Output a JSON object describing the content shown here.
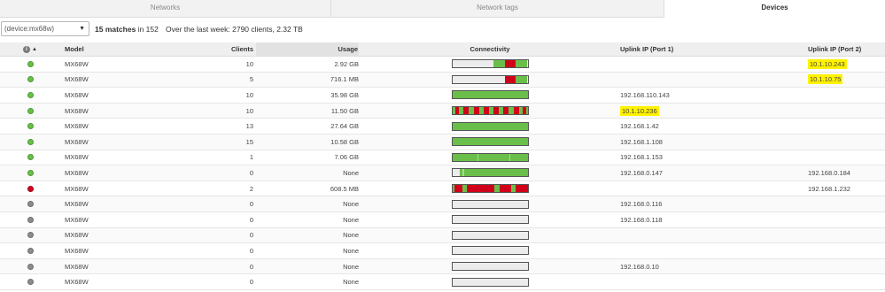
{
  "tabs": [
    {
      "label": "Networks",
      "active": false
    },
    {
      "label": "Network tags",
      "active": false
    },
    {
      "label": "Devices",
      "active": true
    }
  ],
  "toolbar": {
    "search_value": "(device:mx68w)",
    "matches_count": "15 matches",
    "matches_total": "in 152",
    "summary": "Over the last week: 2790 clients, 2.32 TB"
  },
  "columns": {
    "status_icon": "info-icon",
    "model": "Model",
    "clients": "Clients",
    "usage": "Usage",
    "connectivity": "Connectivity",
    "uplink1": "Uplink IP (Port 1)",
    "uplink2": "Uplink IP (Port 2)"
  },
  "colors": {
    "online": "#6abf4b",
    "offline": "#d0021b",
    "dormant": "#8c8c8c",
    "highlight": "#fff200"
  },
  "rows": [
    {
      "status": "online",
      "model": "MX68W",
      "clients": "10",
      "usage": "2.92 GB",
      "uplink1": "",
      "uplink2": "10.1.10.243",
      "uplink1_hl": false,
      "uplink2_hl": true,
      "connectivity": [
        {
          "s": 0,
          "e": 0.55,
          "c": "none"
        },
        {
          "s": 0.55,
          "e": 0.7,
          "c": "green"
        },
        {
          "s": 0.7,
          "e": 0.84,
          "c": "red"
        },
        {
          "s": 0.84,
          "e": 1,
          "c": "green"
        }
      ]
    },
    {
      "status": "online",
      "model": "MX68W",
      "clients": "5",
      "usage": "716.1 MB",
      "uplink1": "",
      "uplink2": "10.1.10.75",
      "uplink1_hl": false,
      "uplink2_hl": true,
      "connectivity": [
        {
          "s": 0,
          "e": 0.7,
          "c": "none"
        },
        {
          "s": 0.7,
          "e": 0.84,
          "c": "red"
        },
        {
          "s": 0.84,
          "e": 1,
          "c": "green"
        }
      ]
    },
    {
      "status": "online",
      "model": "MX68W",
      "clients": "10",
      "usage": "35.98 GB",
      "uplink1": "192.168.110.143",
      "uplink2": "",
      "uplink1_hl": false,
      "uplink2_hl": false,
      "connectivity": [
        {
          "s": 0,
          "e": 1,
          "c": "green"
        }
      ]
    },
    {
      "status": "online",
      "model": "MX68W",
      "clients": "10",
      "usage": "11.50 GB",
      "uplink1": "10.1.10.236",
      "uplink2": "",
      "uplink1_hl": true,
      "uplink2_hl": false,
      "connectivity": [
        {
          "s": 0,
          "e": 1,
          "c": "green"
        },
        {
          "s": 0.04,
          "e": 0.09,
          "c": "red"
        },
        {
          "s": 0.15,
          "e": 0.22,
          "c": "red"
        },
        {
          "s": 0.29,
          "e": 0.36,
          "c": "red"
        },
        {
          "s": 0.42,
          "e": 0.49,
          "c": "red"
        },
        {
          "s": 0.55,
          "e": 0.62,
          "c": "red"
        },
        {
          "s": 0.68,
          "e": 0.75,
          "c": "red"
        },
        {
          "s": 0.82,
          "e": 0.89,
          "c": "red"
        },
        {
          "s": 0.93,
          "e": 0.98,
          "c": "red"
        }
      ]
    },
    {
      "status": "online",
      "model": "MX68W",
      "clients": "13",
      "usage": "27.64 GB",
      "uplink1": "192.168.1.42",
      "uplink2": "",
      "uplink1_hl": false,
      "uplink2_hl": false,
      "connectivity": [
        {
          "s": 0,
          "e": 1,
          "c": "green"
        }
      ]
    },
    {
      "status": "online",
      "model": "MX68W",
      "clients": "15",
      "usage": "10.58 GB",
      "uplink1": "192.168.1.108",
      "uplink2": "",
      "uplink1_hl": false,
      "uplink2_hl": false,
      "connectivity": [
        {
          "s": 0,
          "e": 1,
          "c": "green"
        }
      ]
    },
    {
      "status": "online",
      "model": "MX68W",
      "clients": "1",
      "usage": "7.06 GB",
      "uplink1": "192.168.1.153",
      "uplink2": "",
      "uplink1_hl": false,
      "uplink2_hl": false,
      "connectivity": [
        {
          "s": 0,
          "e": 1,
          "c": "green"
        },
        {
          "s": 0.33,
          "e": 0.345,
          "c": "lightgreen"
        },
        {
          "s": 0.76,
          "e": 0.775,
          "c": "lightgreen"
        }
      ]
    },
    {
      "status": "online",
      "model": "MX68W",
      "clients": "0",
      "usage": "None",
      "uplink1": "192.168.0.147",
      "uplink2": "192.168.0.184",
      "uplink1_hl": false,
      "uplink2_hl": false,
      "connectivity": [
        {
          "s": 0,
          "e": 0.1,
          "c": "none"
        },
        {
          "s": 0.1,
          "e": 1,
          "c": "green"
        },
        {
          "s": 0.14,
          "e": 0.155,
          "c": "lightgreen"
        }
      ]
    },
    {
      "status": "offline",
      "model": "MX68W",
      "clients": "2",
      "usage": "608.5 MB",
      "uplink1": "",
      "uplink2": "192.168.1.232",
      "uplink1_hl": false,
      "uplink2_hl": false,
      "connectivity": [
        {
          "s": 0,
          "e": 1,
          "c": "red"
        },
        {
          "s": 0.0,
          "e": 0.03,
          "c": "green"
        },
        {
          "s": 0.13,
          "e": 0.2,
          "c": "green"
        },
        {
          "s": 0.56,
          "e": 0.63,
          "c": "green"
        },
        {
          "s": 0.78,
          "e": 0.84,
          "c": "green"
        }
      ]
    },
    {
      "status": "dormant",
      "model": "MX68W",
      "clients": "0",
      "usage": "None",
      "uplink1": "192.168.0.116",
      "uplink2": "",
      "uplink1_hl": false,
      "uplink2_hl": false,
      "connectivity": []
    },
    {
      "status": "dormant",
      "model": "MX68W",
      "clients": "0",
      "usage": "None",
      "uplink1": "192.168.0.118",
      "uplink2": "",
      "uplink1_hl": false,
      "uplink2_hl": false,
      "connectivity": []
    },
    {
      "status": "dormant",
      "model": "MX68W",
      "clients": "0",
      "usage": "None",
      "uplink1": "",
      "uplink2": "",
      "uplink1_hl": false,
      "uplink2_hl": false,
      "connectivity": []
    },
    {
      "status": "dormant",
      "model": "MX68W",
      "clients": "0",
      "usage": "None",
      "uplink1": "",
      "uplink2": "",
      "uplink1_hl": false,
      "uplink2_hl": false,
      "connectivity": []
    },
    {
      "status": "dormant",
      "model": "MX68W",
      "clients": "0",
      "usage": "None",
      "uplink1": "192.168.0.10",
      "uplink2": "",
      "uplink1_hl": false,
      "uplink2_hl": false,
      "connectivity": []
    },
    {
      "status": "dormant",
      "model": "MX68W",
      "clients": "0",
      "usage": "None",
      "uplink1": "",
      "uplink2": "",
      "uplink1_hl": false,
      "uplink2_hl": false,
      "connectivity": []
    }
  ]
}
